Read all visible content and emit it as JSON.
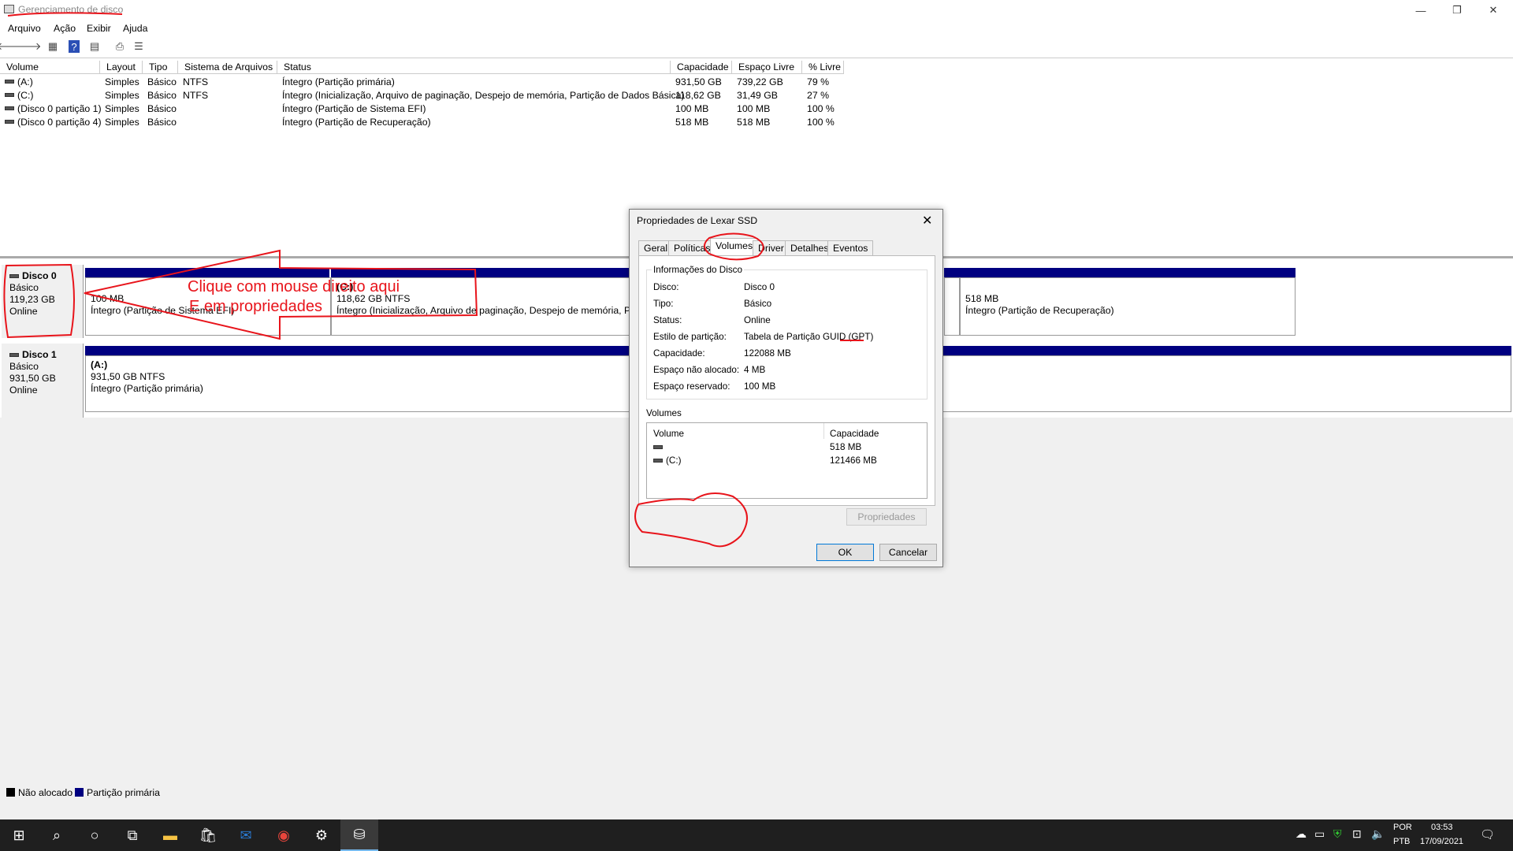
{
  "window": {
    "title": "Gerenciamento de disco",
    "minimize_icon": "minimize-icon",
    "restore_icon": "restore-icon",
    "close_icon": "close-icon"
  },
  "menu": [
    "Arquivo",
    "Ação",
    "Exibir",
    "Ajuda"
  ],
  "list": {
    "columns": [
      "Volume",
      "Layout",
      "Tipo",
      "Sistema de Arquivos",
      "Status",
      "Capacidade",
      "Espaço Livre",
      "% Livre"
    ],
    "rows": [
      [
        "(A:)",
        "Simples",
        "Básico",
        "NTFS",
        "Íntegro (Partição primária)",
        "931,50 GB",
        "739,22 GB",
        "79 %"
      ],
      [
        "(C:)",
        "Simples",
        "Básico",
        "NTFS",
        "Íntegro (Inicialização, Arquivo de paginação, Despejo de memória, Partição de Dados Básica)",
        "118,62 GB",
        "31,49 GB",
        "27 %"
      ],
      [
        "(Disco 0 partição 1)",
        "Simples",
        "Básico",
        "",
        "Íntegro (Partição de Sistema EFI)",
        "100 MB",
        "100 MB",
        "100 %"
      ],
      [
        "(Disco 0 partição 4)",
        "Simples",
        "Básico",
        "",
        "Íntegro (Partição de Recuperação)",
        "518 MB",
        "518 MB",
        "100 %"
      ]
    ]
  },
  "disks": {
    "disk0": {
      "name": "Disco 0",
      "type": "Básico",
      "size": "119,23 GB",
      "status": "Online",
      "p1": {
        "size": "100 MB",
        "status": "Íntegro (Partição de Sistema EFI)"
      },
      "p2": {
        "name": "(C:)",
        "size": "118,62 GB NTFS",
        "status": "Íntegro (Inicialização, Arquivo de paginação, Despejo de memória, Par"
      },
      "p4": {
        "size": "518 MB",
        "status": "Íntegro (Partição de Recuperação)"
      }
    },
    "disk1": {
      "name": "Disco 1",
      "type": "Básico",
      "size": "931,50 GB",
      "status": "Online",
      "p1": {
        "name": "(A:)",
        "size": "931,50 GB NTFS",
        "status": "Íntegro (Partição primária)"
      }
    }
  },
  "annotation": {
    "line1": "Clique com mouse direito aqui",
    "line2": "E em propriedades",
    "color": "#e8141b"
  },
  "legend": {
    "unallocated": "Não alocado",
    "primary": "Partição primária"
  },
  "dialog": {
    "title": "Propriedades de Lexar SSD",
    "tabs": [
      "Geral",
      "Políticas",
      "Volumes",
      "Driver",
      "Detalhes",
      "Eventos"
    ],
    "group_title": "Informações do Disco",
    "info": [
      [
        "Disco:",
        "Disco 0"
      ],
      [
        "Tipo:",
        "Básico"
      ],
      [
        "Status:",
        "Online"
      ],
      [
        "Estilo de partição:",
        "Tabela de Partição GUID (GPT)"
      ],
      [
        "Capacidade:",
        "122088 MB"
      ],
      [
        "Espaço não alocado:",
        "4 MB"
      ],
      [
        "Espaço reservado:",
        "100 MB"
      ]
    ],
    "volumes_title": "Volumes",
    "vol_columns": [
      "Volume",
      "Capacidade"
    ],
    "volumes": [
      [
        "",
        "518 MB"
      ],
      [
        "(C:)",
        "121466 MB"
      ]
    ],
    "properties_button": "Propriedades",
    "ok": "OK",
    "cancel": "Cancelar"
  },
  "taskbar": {
    "lang1": "POR",
    "lang2": "PTB",
    "time": "03:53",
    "date": "17/09/2021"
  },
  "colors": {
    "primary_partition": "#000080",
    "taskbar": "#1f1f1f"
  }
}
